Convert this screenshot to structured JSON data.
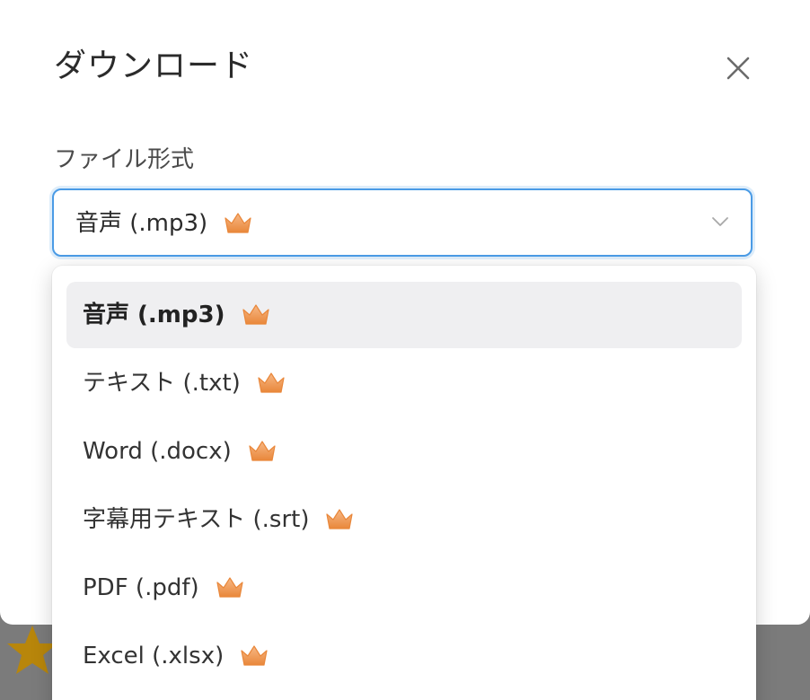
{
  "dialog": {
    "title": "ダウンロード",
    "close_icon": "close-icon"
  },
  "format_field": {
    "label": "ファイル形式",
    "selected_value": "音声 (.mp3)",
    "premium_icon": "crown-icon",
    "chevron_icon": "chevron-down-icon"
  },
  "dropdown": {
    "options": [
      {
        "label": "音声 (.mp3)",
        "selected": true,
        "premium": true
      },
      {
        "label": "テキスト (.txt)",
        "selected": false,
        "premium": true
      },
      {
        "label": "Word (.docx)",
        "selected": false,
        "premium": true
      },
      {
        "label": "字幕用テキスト (.srt)",
        "selected": false,
        "premium": true
      },
      {
        "label": "PDF (.pdf)",
        "selected": false,
        "premium": true
      },
      {
        "label": "Excel (.xlsx)",
        "selected": false,
        "premium": true
      }
    ]
  },
  "colors": {
    "accent_border": "#4a9be6",
    "crown_light": "#f6b07a",
    "crown_dark": "#ea8a3c",
    "backdrop_star": "#c48a12"
  }
}
